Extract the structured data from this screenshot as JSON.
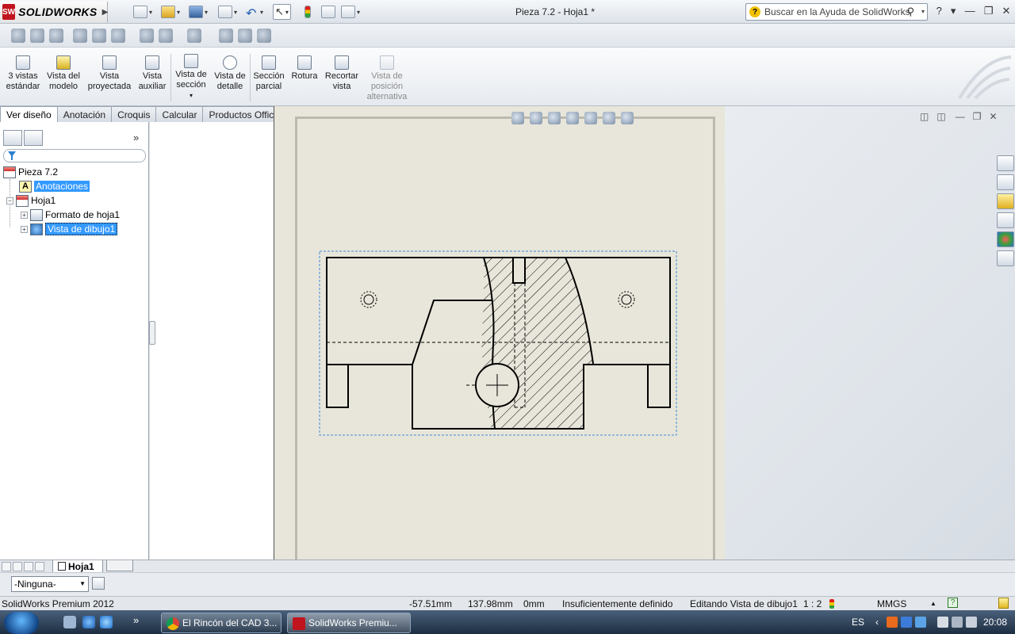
{
  "app": {
    "logo_text": "SOLIDWORKS",
    "logo_mark": "SW",
    "doc_title": "Pieza 7.2 - Hoja1 *"
  },
  "search": {
    "placeholder": "Buscar en la Ayuda de SolidWorks"
  },
  "window_controls": [
    "?",
    "▾",
    "—",
    "❐",
    "✕"
  ],
  "ribbon": {
    "items": [
      {
        "label": "3 vistas estándar",
        "icon": "three-views-icon",
        "enabled": true
      },
      {
        "label": "Vista del modelo",
        "icon": "model-view-icon",
        "enabled": true
      },
      {
        "label": "Vista proyectada",
        "icon": "projected-view-icon",
        "enabled": true
      },
      {
        "label": "Vista auxiliar",
        "icon": "auxiliary-view-icon",
        "enabled": true
      },
      {
        "label": "Vista de sección",
        "icon": "section-view-icon",
        "enabled": true
      },
      {
        "label": "Vista de detalle",
        "icon": "detail-view-icon",
        "enabled": true
      },
      {
        "label": "Sección parcial",
        "icon": "broken-out-section-icon",
        "enabled": true
      },
      {
        "label": "Rotura",
        "icon": "break-icon",
        "enabled": true
      },
      {
        "label": "Recortar vista",
        "icon": "crop-view-icon",
        "enabled": true
      },
      {
        "label": "Vista de posición alternativa",
        "icon": "alternate-position-icon",
        "enabled": false
      }
    ]
  },
  "tabs": [
    {
      "label": "Ver diseño",
      "active": true
    },
    {
      "label": "Anotación",
      "active": false
    },
    {
      "label": "Croquis",
      "active": false
    },
    {
      "label": "Calcular",
      "active": false
    },
    {
      "label": "Productos Office",
      "active": false
    }
  ],
  "tree": {
    "root": "Pieza 7.2",
    "annotations": "Anotaciones",
    "sheet": "Hoja1",
    "sheet_format": "Formato de hoja1",
    "drawing_view": "Vista de dibujo1"
  },
  "sheet_tab": {
    "label": "Hoja1"
  },
  "layer": {
    "selected": "-Ninguna-"
  },
  "status": {
    "product": "SolidWorks Premium 2012",
    "x": "-57.51mm",
    "y": "137.98mm",
    "z": "0mm",
    "definition": "Insuficientemente definido",
    "editing": "Editando Vista de dibujo1",
    "scale": "1 : 2",
    "units": "MMGS"
  },
  "taskbar": {
    "tasks": [
      "El Rincón del CAD 3...",
      "SolidWorks Premiu..."
    ],
    "lang": "ES",
    "clock": "20:08"
  },
  "colors": {
    "selection": "#3399ff",
    "sheet": "#e8e6da",
    "viewport_border": "#3b8ad9"
  }
}
